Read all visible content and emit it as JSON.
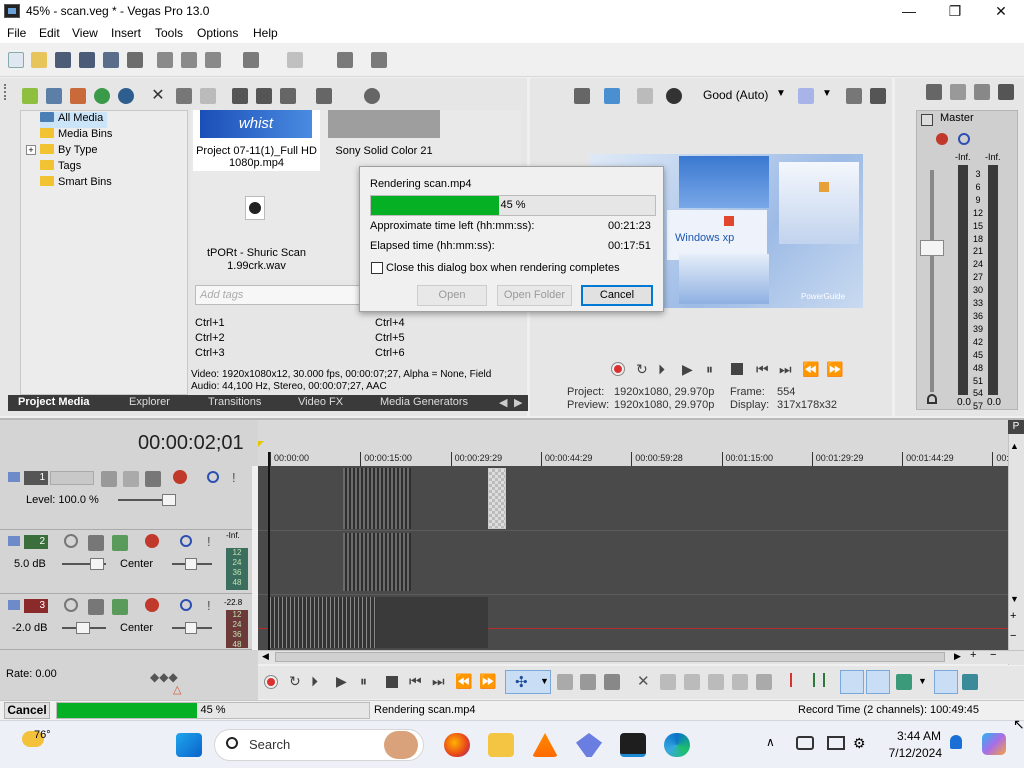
{
  "window": {
    "title": "45% - scan.veg * - Vegas Pro 13.0",
    "minimize": "—",
    "maximize": "❐",
    "close": "✕"
  },
  "menu": [
    "File",
    "Edit",
    "View",
    "Insert",
    "Tools",
    "Options",
    "Help"
  ],
  "media_tree": {
    "items": [
      "All Media",
      "Media Bins",
      "By Type",
      "Tags",
      "Smart Bins"
    ],
    "expander": "+"
  },
  "media_list": {
    "items": [
      {
        "name": "Project 07-11(1)_Full HD 1080p.mp4",
        "line1": "Project 07-11(1)_Full HD",
        "line2": "1080p.mp4",
        "thumb_text": "whist"
      },
      {
        "name": "Sony Solid Color 21",
        "line1": "Sony Solid Color 21"
      },
      {
        "name": "tPORt - Shuric Scan 1.99crk.wav",
        "line1": "tPORt - Shuric Scan",
        "line2": "1.99crk.wav"
      }
    ],
    "tag_placeholder": "Add tags",
    "shortcuts": [
      "Ctrl+1",
      "Ctrl+2",
      "Ctrl+3",
      "Ctrl+4",
      "Ctrl+5",
      "Ctrl+6"
    ],
    "info_video": "Video: 1920x1080x12, 30.000 fps, 00:00:07;27, Alpha = None, Field",
    "info_audio": "Audio: 44,100 Hz, Stereo, 00:00:07;27, AAC"
  },
  "bottom_tabs": [
    "Project Media",
    "Explorer",
    "Transitions",
    "Video FX",
    "Media Generators"
  ],
  "preview": {
    "quality": "Good (Auto)",
    "project_label": "Project:",
    "project_value": "1920x1080, 29.970p",
    "preview_label": "Preview:",
    "preview_value": "1920x1080, 29.970p",
    "frame_label": "Frame:",
    "frame_value": "554",
    "display_label": "Display:",
    "display_value": "317x178x32",
    "watermark": "PowerGuide",
    "xp_text": "Windows xp"
  },
  "master": {
    "title": "Master",
    "inf_left": "-Inf.",
    "inf_right": "-Inf.",
    "scale": [
      "3",
      "6",
      "9",
      "12",
      "15",
      "18",
      "21",
      "24",
      "27",
      "30",
      "33",
      "36",
      "39",
      "42",
      "45",
      "48",
      "51",
      "54",
      "57"
    ],
    "val_left": "0.0",
    "val_right": "0.0"
  },
  "dialog": {
    "title": "Rendering scan.mp4",
    "progress_label": "45 %",
    "progress": 0.45,
    "time_left_label": "Approximate time left (hh:mm:ss):",
    "time_left": "00:21:23",
    "elapsed_label": "Elapsed time (hh:mm:ss):",
    "elapsed": "00:17:51",
    "close_when_done": "Close this dialog box when rendering completes",
    "open": "Open",
    "open_folder": "Open Folder",
    "cancel": "Cancel"
  },
  "timeline": {
    "timecode": "00:00:02;01",
    "ruler": [
      "00:00:00",
      "00:00:15:00",
      "00:00:29:29",
      "00:00:44:29",
      "00:00:59:28",
      "00:01:15:00",
      "00:01:29:29",
      "00:01:44:29",
      "00:0"
    ],
    "tracks": [
      {
        "num": "1",
        "label_key": "Level:",
        "value": "Level: 100.0 %"
      },
      {
        "num": "2",
        "db": "5.0 dB",
        "pan": "Center",
        "meter_top": "-Inf.",
        "meter": [
          "12",
          "24",
          "36",
          "48"
        ]
      },
      {
        "num": "3",
        "db": "-2.0 dB",
        "pan": "Center",
        "meter_top": "-22.8",
        "meter": [
          "12",
          "24",
          "36",
          "48"
        ]
      }
    ],
    "rate": "Rate: 0.00"
  },
  "statusbar": {
    "cancel": "Cancel",
    "progress_label": "45 %",
    "progress": 0.45,
    "rendering": "Rendering scan.mp4",
    "record_time": "Record Time (2 channels): 100:49:45"
  },
  "taskbar": {
    "weather": "76°",
    "search": "Search",
    "time": "3:44 AM",
    "date": "7/12/2024"
  },
  "colors": {
    "progress_green": "#06b025",
    "timeline_bg": "#4a4a4a",
    "accent": "#0078d4"
  }
}
